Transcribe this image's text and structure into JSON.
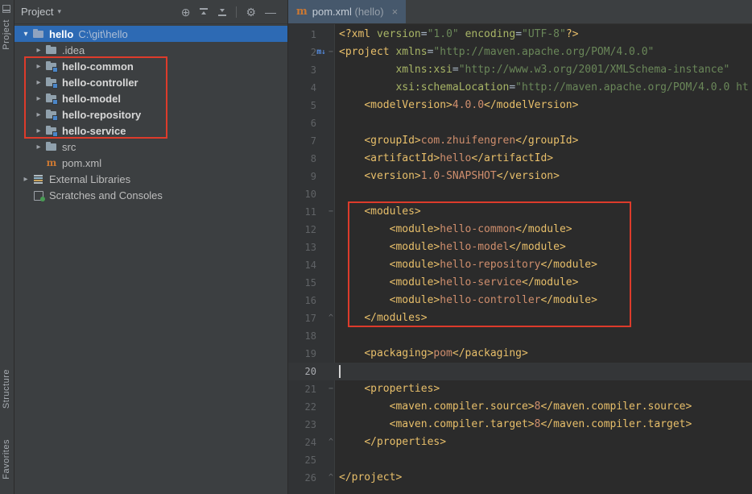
{
  "colors": {
    "selection_blue": "#2d6ab4",
    "annotation_red": "#dd3b2b",
    "editor_background": "#2b2b2b",
    "panel_background": "#3c3f41",
    "xml_tag": "#e8bf6a",
    "xml_attribute": "#a8b566",
    "xml_string": "#6a8759",
    "xml_text": "#cf8e6d"
  },
  "tool_stripes": {
    "left_top": "Project",
    "left_middle": "Structure",
    "left_bottom": "Favorites"
  },
  "project_panel": {
    "title": "Project",
    "title_caret": "▾",
    "toolbar_icons": [
      "locate",
      "collapse-all-up",
      "collapse-all-down",
      "settings",
      "hide"
    ],
    "locate_glyph": "⊕",
    "settings_glyph": "⚙",
    "hide_glyph": "—",
    "tree": [
      {
        "label": "hello",
        "path": "C:\\git\\hello",
        "icon": "project-folder",
        "chevron": "down",
        "bold": true,
        "selected": true,
        "indent": 0
      },
      {
        "label": ".idea",
        "icon": "folder",
        "chevron": "right",
        "bold": false,
        "indent": 1
      },
      {
        "label": "hello-common",
        "icon": "module",
        "chevron": "right",
        "bold": true,
        "indent": 1
      },
      {
        "label": "hello-controller",
        "icon": "module",
        "chevron": "right",
        "bold": true,
        "indent": 1
      },
      {
        "label": "hello-model",
        "icon": "module",
        "chevron": "right",
        "bold": true,
        "indent": 1
      },
      {
        "label": "hello-repository",
        "icon": "module",
        "chevron": "right",
        "bold": true,
        "indent": 1
      },
      {
        "label": "hello-service",
        "icon": "module",
        "chevron": "right",
        "bold": true,
        "indent": 1
      },
      {
        "label": "src",
        "icon": "folder",
        "chevron": "right",
        "bold": false,
        "indent": 1
      },
      {
        "label": "pom.xml",
        "icon": "maven",
        "chevron": null,
        "bold": false,
        "indent": 1
      },
      {
        "label": "External Libraries",
        "icon": "libraries",
        "chevron": "right",
        "bold": false,
        "indent": 0
      },
      {
        "label": "Scratches and Consoles",
        "icon": "scratches",
        "chevron": null,
        "bold": false,
        "indent": 0
      }
    ]
  },
  "editor": {
    "tab": {
      "icon": "maven",
      "icon_glyph": "m",
      "title": "pom.xml",
      "suffix": " (hello)",
      "close": "×"
    },
    "caret_line": 20,
    "lines": [
      {
        "n": 1,
        "tokens": [
          [
            "t",
            "<?xml "
          ],
          [
            "a",
            "version"
          ],
          [
            "p",
            "="
          ],
          [
            "s",
            "\"1.0\""
          ],
          [
            "p",
            " "
          ],
          [
            "a",
            "encoding"
          ],
          [
            "p",
            "="
          ],
          [
            "s",
            "\"UTF-8\""
          ],
          [
            "t",
            "?>"
          ]
        ]
      },
      {
        "n": 2,
        "badge": "maven",
        "fold": "start",
        "tokens": [
          [
            "t",
            "<project "
          ],
          [
            "a",
            "xmlns"
          ],
          [
            "p",
            "="
          ],
          [
            "s",
            "\"http://maven.apache.org/POM/4.0.0\""
          ]
        ]
      },
      {
        "n": 3,
        "tokens": [
          [
            "p",
            "         "
          ],
          [
            "a",
            "xmlns:xsi"
          ],
          [
            "p",
            "="
          ],
          [
            "s",
            "\"http://www.w3.org/2001/XMLSchema-instance\""
          ]
        ]
      },
      {
        "n": 4,
        "tokens": [
          [
            "p",
            "         "
          ],
          [
            "a",
            "xsi:schemaLocation"
          ],
          [
            "p",
            "="
          ],
          [
            "s",
            "\"http://maven.apache.org/POM/4.0.0 ht"
          ]
        ]
      },
      {
        "n": 5,
        "tokens": [
          [
            "p",
            "    "
          ],
          [
            "t",
            "<modelVersion>"
          ],
          [
            "x",
            "4.0.0"
          ],
          [
            "t",
            "</modelVersion>"
          ]
        ]
      },
      {
        "n": 6,
        "tokens": []
      },
      {
        "n": 7,
        "tokens": [
          [
            "p",
            "    "
          ],
          [
            "t",
            "<groupId>"
          ],
          [
            "x",
            "com.zhuifengren"
          ],
          [
            "t",
            "</groupId>"
          ]
        ]
      },
      {
        "n": 8,
        "tokens": [
          [
            "p",
            "    "
          ],
          [
            "t",
            "<artifactId>"
          ],
          [
            "x",
            "hello"
          ],
          [
            "t",
            "</artifactId>"
          ]
        ]
      },
      {
        "n": 9,
        "tokens": [
          [
            "p",
            "    "
          ],
          [
            "t",
            "<version>"
          ],
          [
            "x",
            "1.0-SNAPSHOT"
          ],
          [
            "t",
            "</version>"
          ]
        ]
      },
      {
        "n": 10,
        "tokens": []
      },
      {
        "n": 11,
        "fold": "start",
        "tokens": [
          [
            "p",
            "    "
          ],
          [
            "t",
            "<modules>"
          ]
        ]
      },
      {
        "n": 12,
        "tokens": [
          [
            "p",
            "        "
          ],
          [
            "t",
            "<module>"
          ],
          [
            "x",
            "hello-common"
          ],
          [
            "t",
            "</module>"
          ]
        ]
      },
      {
        "n": 13,
        "tokens": [
          [
            "p",
            "        "
          ],
          [
            "t",
            "<module>"
          ],
          [
            "x",
            "hello-model"
          ],
          [
            "t",
            "</module>"
          ]
        ]
      },
      {
        "n": 14,
        "tokens": [
          [
            "p",
            "        "
          ],
          [
            "t",
            "<module>"
          ],
          [
            "x",
            "hello-repository"
          ],
          [
            "t",
            "</module>"
          ]
        ]
      },
      {
        "n": 15,
        "tokens": [
          [
            "p",
            "        "
          ],
          [
            "t",
            "<module>"
          ],
          [
            "x",
            "hello-service"
          ],
          [
            "t",
            "</module>"
          ]
        ]
      },
      {
        "n": 16,
        "tokens": [
          [
            "p",
            "        "
          ],
          [
            "t",
            "<module>"
          ],
          [
            "x",
            "hello-controller"
          ],
          [
            "t",
            "</module>"
          ]
        ]
      },
      {
        "n": 17,
        "fold": "end",
        "tokens": [
          [
            "p",
            "    "
          ],
          [
            "t",
            "</modules>"
          ]
        ]
      },
      {
        "n": 18,
        "tokens": []
      },
      {
        "n": 19,
        "tokens": [
          [
            "p",
            "    "
          ],
          [
            "t",
            "<packaging>"
          ],
          [
            "x",
            "pom"
          ],
          [
            "t",
            "</packaging>"
          ]
        ]
      },
      {
        "n": 20,
        "tokens": []
      },
      {
        "n": 21,
        "fold": "start",
        "tokens": [
          [
            "p",
            "    "
          ],
          [
            "t",
            "<properties>"
          ]
        ]
      },
      {
        "n": 22,
        "tokens": [
          [
            "p",
            "        "
          ],
          [
            "t",
            "<maven.compiler.source>"
          ],
          [
            "x",
            "8"
          ],
          [
            "t",
            "</maven.compiler.source>"
          ]
        ]
      },
      {
        "n": 23,
        "tokens": [
          [
            "p",
            "        "
          ],
          [
            "t",
            "<maven.compiler.target>"
          ],
          [
            "x",
            "8"
          ],
          [
            "t",
            "</maven.compiler.target>"
          ]
        ]
      },
      {
        "n": 24,
        "fold": "end",
        "tokens": [
          [
            "p",
            "    "
          ],
          [
            "t",
            "</properties>"
          ]
        ]
      },
      {
        "n": 25,
        "tokens": []
      },
      {
        "n": 26,
        "fold": "end",
        "tokens": [
          [
            "t",
            "</project>"
          ]
        ]
      }
    ]
  },
  "annotations": {
    "tree_highlight": "red box around hello-* modules in project tree",
    "editor_highlight": "red box around modules block in pom.xml"
  }
}
